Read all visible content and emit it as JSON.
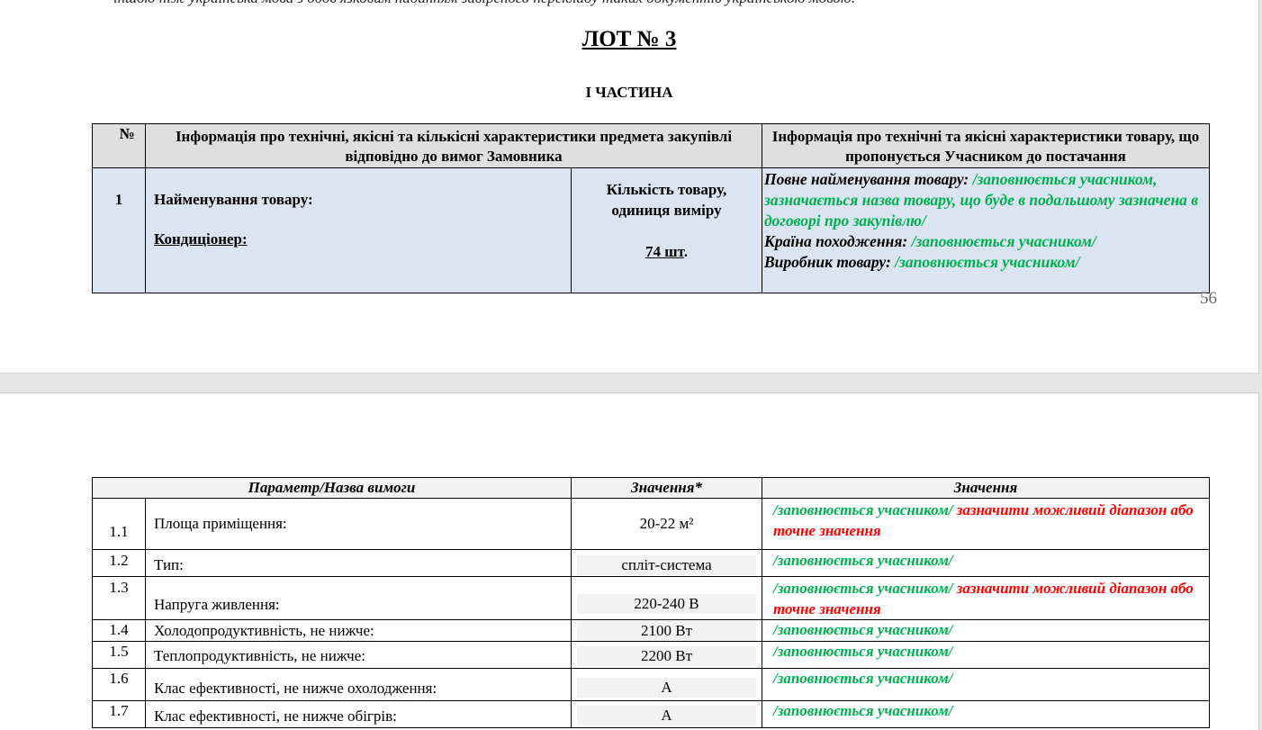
{
  "page1": {
    "cut_line": "іншою ніж українська мова з обов'язковим наданням завіреного перекладу таких документів українською мовою.",
    "lot_title": "ЛОТ № 3",
    "part_title": "І ЧАСТИНА",
    "page_number": "56",
    "header": {
      "col_num": "№",
      "col_customer": "Інформація про технічні, якісні та кількісні характеристики предмета закупівлі відповідно до вимог Замовника",
      "col_participant": "Інформація про технічні та якісні характеристики товару, що пропонується Учасником до постачання"
    },
    "row": {
      "num": "1",
      "name_label": "Найменування товару:",
      "name_value": "Кондиціонер:",
      "qty_label": "Кількість товару, одиниця виміру",
      "qty_value": "74 шт",
      "qty_suffix": ".",
      "full_name_label": "Повне найменування товару:",
      "full_name_hint": "/заповнюється учасником, зазначається назва товару, що буде в подальшому зазначена в договорі про закупівлю/",
      "country_label": "Країна походження:",
      "country_hint": "/заповнюється учасником/",
      "maker_label": "Виробник товару:",
      "maker_hint": "/заповнюється учасником/"
    }
  },
  "page2": {
    "header": {
      "param": "Параметр/Назва вимоги",
      "value_required": "Значення*",
      "value_offered": "Значення"
    },
    "rows": [
      {
        "num": "1.1",
        "param": "Площа приміщення:",
        "value": "20-22 м²",
        "hint": "/заповнюється учасником/",
        "note": "зазначити можливий діапазон або точне значення"
      },
      {
        "num": "1.2",
        "param": "Тип:",
        "value": "спліт-система",
        "hint": "/заповнюється учасником/",
        "note": ""
      },
      {
        "num": "1.3",
        "param": "Напруга живлення:",
        "value": "220-240 В",
        "hint": "/заповнюється учасником/",
        "note": "зазначити можливий діапазон або точне значення"
      },
      {
        "num": "1.4",
        "param": "Холодопродуктивність, не нижче:",
        "value": "2100 Вт",
        "hint": "/заповнюється учасником/",
        "note": ""
      },
      {
        "num": "1.5",
        "param": "Теплопродуктивність, не нижче:",
        "value": "2200 Вт",
        "hint": "/заповнюється учасником/",
        "note": ""
      },
      {
        "num": "1.6",
        "param": "Клас ефективності, не нижче охолодження:",
        "value": "A",
        "hint": "/заповнюється учасником/",
        "note": ""
      },
      {
        "num": "1.7",
        "param": "Клас ефективності, не нижче обігрів:",
        "value": "A",
        "hint": "/заповнюється учасником/",
        "note": ""
      }
    ]
  }
}
